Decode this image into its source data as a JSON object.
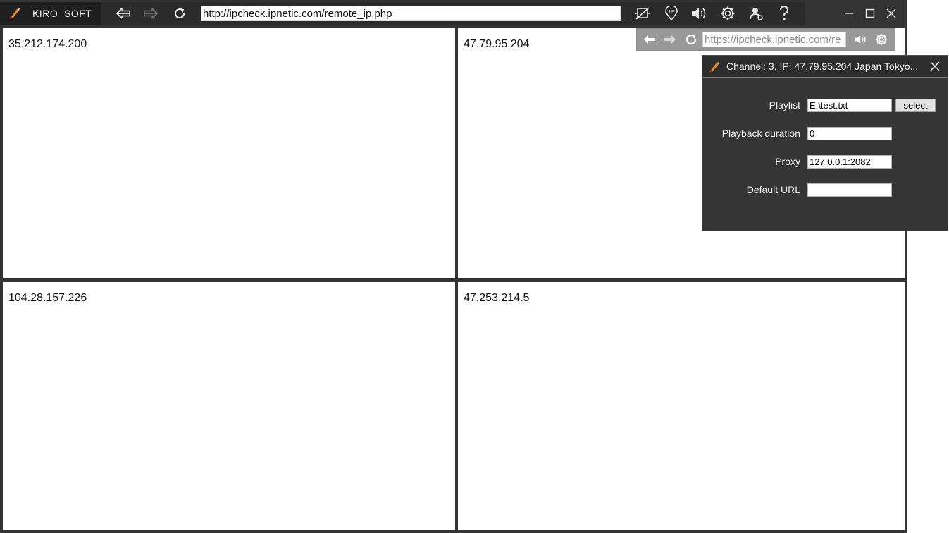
{
  "app": {
    "brand": "KIRO  SOFT",
    "brand_icon": "quill-logo-icon"
  },
  "toolbar": {
    "address": "http://ipcheck.ipnetic.com/remote_ip.php",
    "icons": [
      "back-arrow-icon",
      "forward-arrow-icon",
      "refresh-icon",
      "rotate-screen-icon",
      "ip-pin-icon",
      "speaker-icon",
      "gear-icon",
      "user-settings-icon",
      "help-icon"
    ],
    "window_controls": [
      "minimize-icon",
      "maximize-icon",
      "close-icon"
    ]
  },
  "panels": [
    {
      "ip": "35.212.174.200"
    },
    {
      "ip": "47.79.95.204"
    },
    {
      "ip": "104.28.157.226"
    },
    {
      "ip": "47.253.214.5"
    }
  ],
  "mini_toolbar": {
    "address": "https://ipcheck.ipnetic.com/re"
  },
  "dialog": {
    "title": "Channel: 3, IP: 47.79.95.204 Japan Tokyo...",
    "playlist_label": "Playlist",
    "playlist_value": "E:\\test.txt",
    "select_label": "select",
    "duration_label": "Playback duration",
    "duration_value": "0",
    "proxy_label": "Proxy",
    "proxy_value": "127.0.0.1:2082",
    "default_url_label": "Default URL",
    "default_url_value": ""
  },
  "colors": {
    "chrome": "#333333",
    "brand_bg": "#1f1f1f",
    "dialog_bg": "#353535",
    "mini_bar": "#9a9a9a"
  }
}
